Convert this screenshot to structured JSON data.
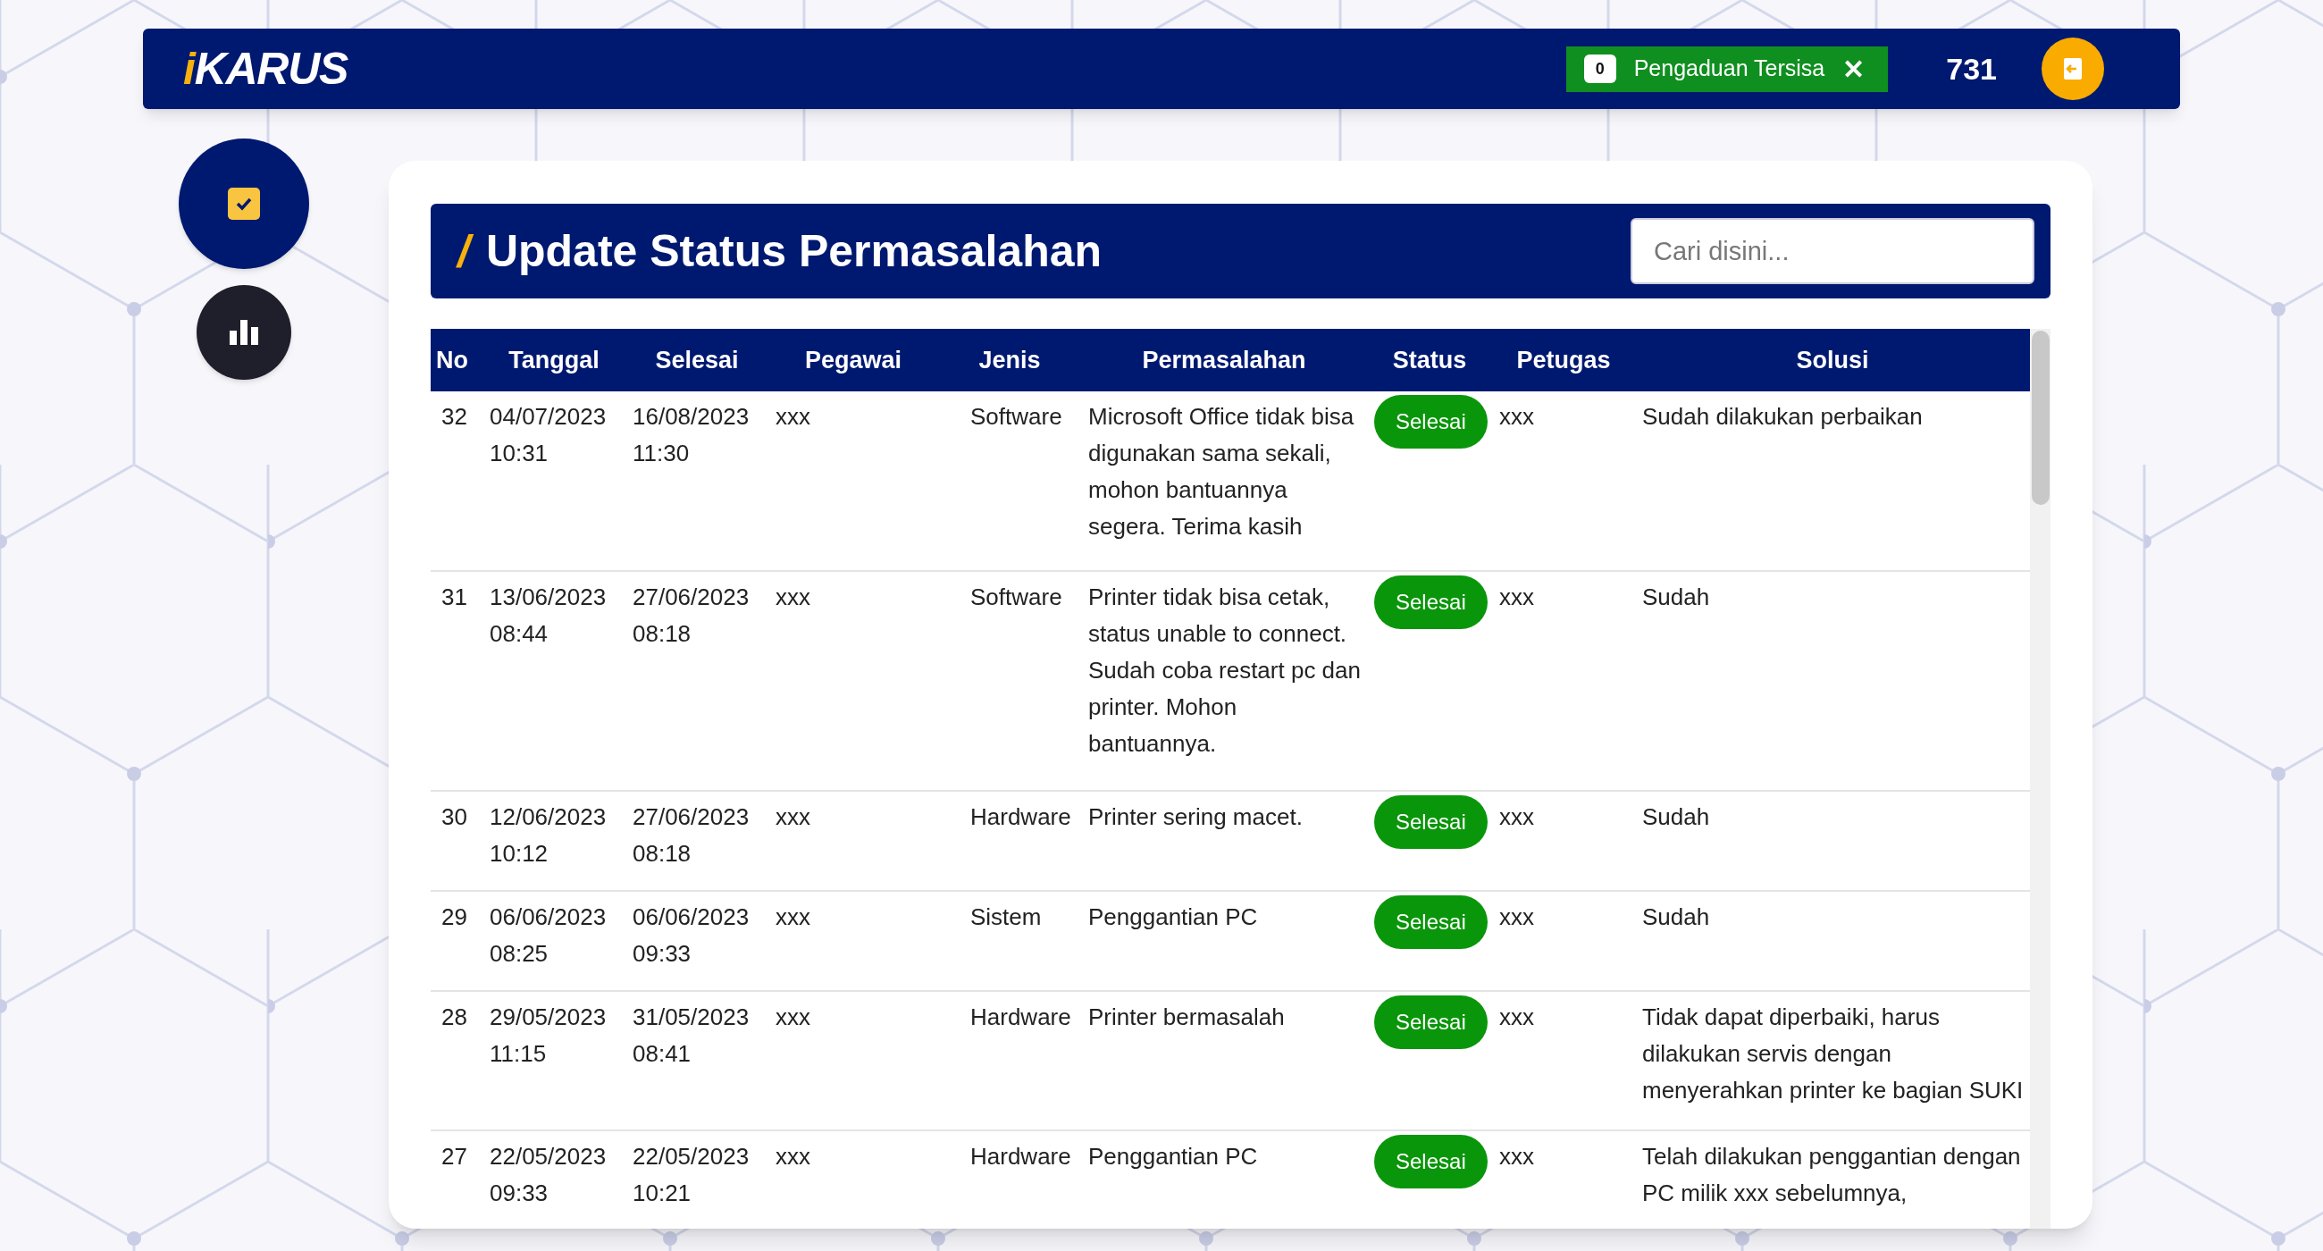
{
  "navbar": {
    "logo_accent": "i",
    "logo_text": "KARUS",
    "badge": {
      "count": "0",
      "label": "Pengaduan Tersisa",
      "close": "✕"
    },
    "counter": "731"
  },
  "sidebar": {
    "items": [
      {
        "kind": "check",
        "selected": true
      },
      {
        "kind": "chart",
        "selected": false
      }
    ]
  },
  "page": {
    "title_mark": "/",
    "title": "Update Status Permasalahan",
    "search": {
      "placeholder": "Cari disini..."
    }
  },
  "table": {
    "columns": [
      "No",
      "Tanggal",
      "Selesai",
      "Pegawai",
      "Jenis",
      "Permasalahan",
      "Status",
      "Petugas",
      "Solusi"
    ],
    "rows": [
      {
        "no": "32",
        "tanggal": "04/07/2023 10:31",
        "selesai": "16/08/2023 11:30",
        "pegawai": "xxx",
        "jenis": "Software",
        "permasalahan": "Microsoft Office tidak bisa digunakan sama sekali, mohon bantuannya segera. Terima kasih",
        "status": "Selesai",
        "petugas": "xxx",
        "solusi": "Sudah dilakukan perbaikan"
      },
      {
        "no": "31",
        "tanggal": "13/06/2023 08:44",
        "selesai": "27/06/2023 08:18",
        "pegawai": "xxx",
        "jenis": "Software",
        "permasalahan": "Printer tidak bisa cetak, status unable to connect. Sudah coba restart pc dan printer. Mohon bantuannya.",
        "status": "Selesai",
        "petugas": "xxx",
        "solusi": "Sudah"
      },
      {
        "no": "30",
        "tanggal": "12/06/2023 10:12",
        "selesai": "27/06/2023 08:18",
        "pegawai": "xxx",
        "jenis": "Hardware",
        "permasalahan": "Printer sering macet.",
        "status": "Selesai",
        "petugas": "xxx",
        "solusi": "Sudah"
      },
      {
        "no": "29",
        "tanggal": "06/06/2023 08:25",
        "selesai": "06/06/2023 09:33",
        "pegawai": "xxx",
        "jenis": "Sistem",
        "permasalahan": "Penggantian PC",
        "status": "Selesai",
        "petugas": "xxx",
        "solusi": "Sudah"
      },
      {
        "no": "28",
        "tanggal": "29/05/2023 11:15",
        "selesai": "31/05/2023 08:41",
        "pegawai": "xxx",
        "jenis": "Hardware",
        "permasalahan": "Printer bermasalah",
        "status": "Selesai",
        "petugas": "xxx",
        "solusi": "Tidak dapat diperbaiki, harus dilakukan servis dengan menyerahkan printer ke bagian SUKI"
      },
      {
        "no": "27",
        "tanggal": "22/05/2023 09:33",
        "selesai": "22/05/2023 10:21",
        "pegawai": "xxx",
        "jenis": "Hardware",
        "permasalahan": "Penggantian PC",
        "status": "Selesai",
        "petugas": "xxx",
        "solusi": "Telah dilakukan penggantian dengan PC milik xxx sebelumnya,"
      }
    ]
  }
}
